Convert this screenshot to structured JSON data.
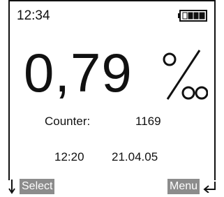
{
  "status_bar": {
    "time": "12:34",
    "battery_icon": "battery-icon",
    "battery_level": 0.75
  },
  "measurement": {
    "value": "0,79",
    "unit_icon": "permille-icon"
  },
  "counter": {
    "label": "Counter:",
    "value": "1169"
  },
  "last_test": {
    "time": "12:20",
    "date": "21.04.05"
  },
  "softkeys": {
    "left_label": "Select",
    "left_icon": "arrow-down-icon",
    "right_label": "Menu",
    "right_icon": "enter-arrow-icon",
    "key_color": "#8c8c8c"
  }
}
